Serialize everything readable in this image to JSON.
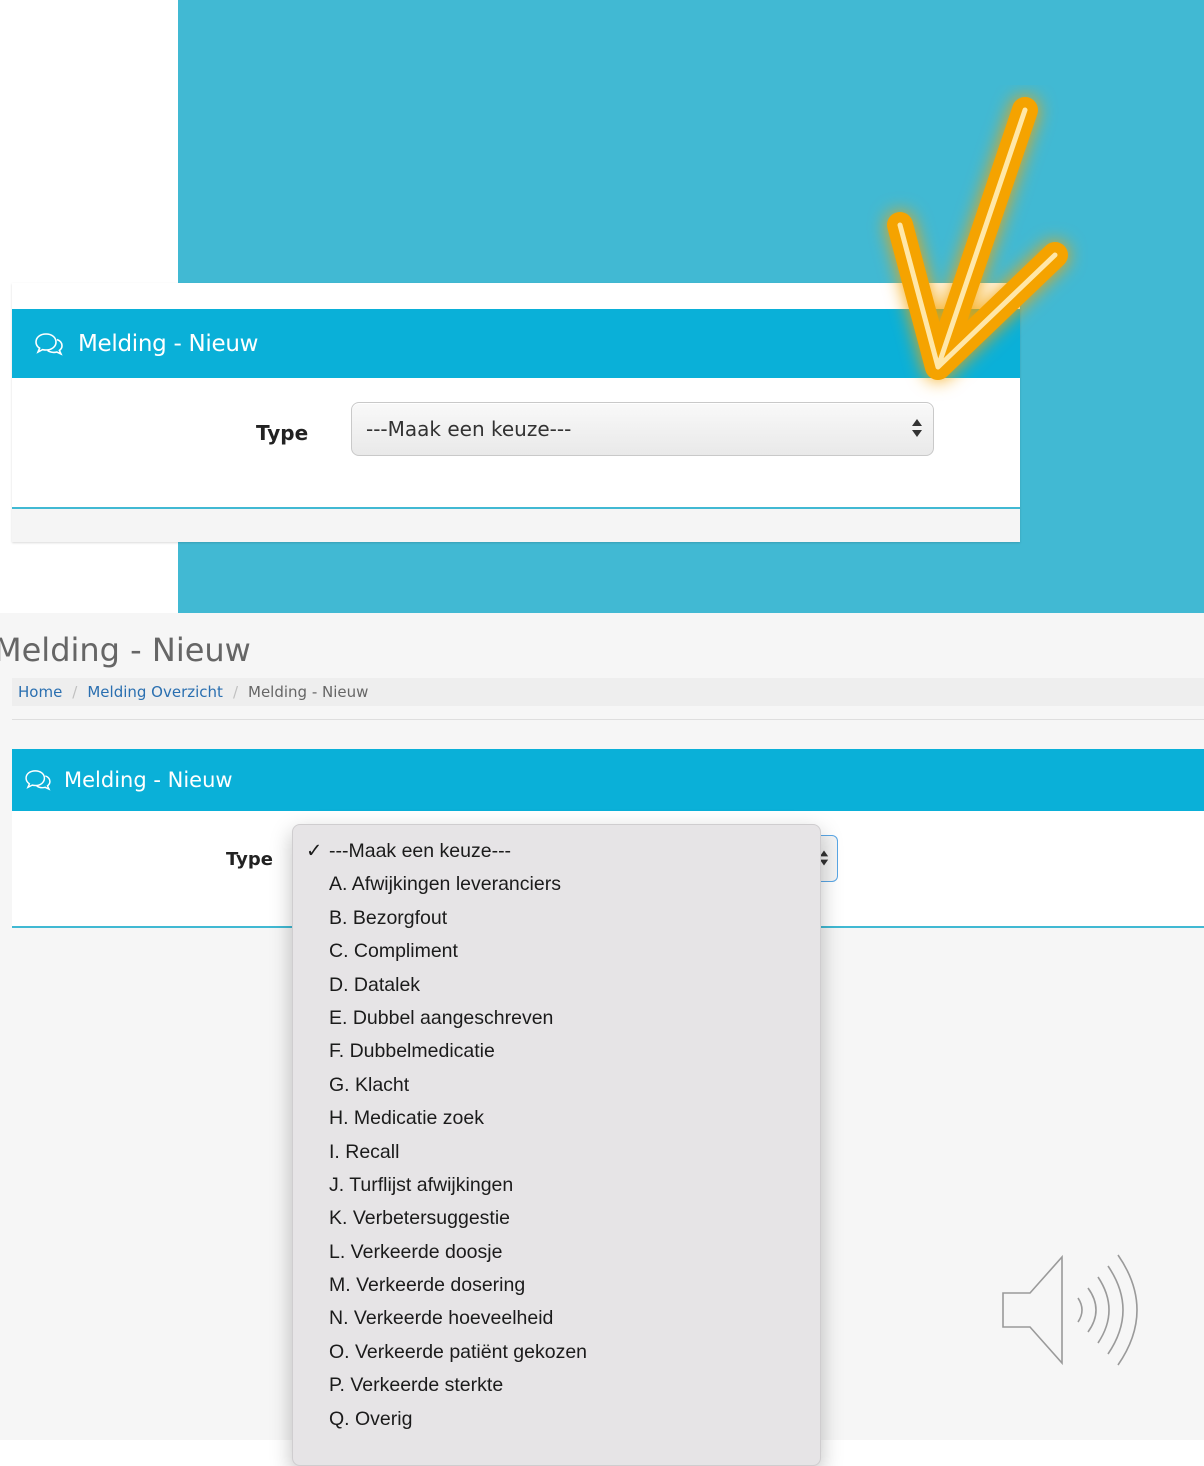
{
  "promo_card": {
    "header_title": "Melding - Nieuw",
    "type_label": "Type",
    "select_value": "---Maak een keuze---"
  },
  "app": {
    "page_title": "Melding - Nieuw",
    "breadcrumb": {
      "home": "Home",
      "overview": "Melding Overzicht",
      "current": "Melding - Nieuw"
    },
    "panel_title": "Melding - Nieuw",
    "type_label": "Type",
    "dropdown": {
      "selected_check": "✓",
      "options": [
        "---Maak een keuze---",
        "A. Afwijkingen leveranciers",
        "B. Bezorgfout",
        "C. Compliment",
        "D. Datalek",
        "E. Dubbel aangeschreven",
        "F. Dubbelmedicatie",
        "G. Klacht",
        "H. Medicatie zoek",
        "I. Recall",
        "J. Turflijst afwijkingen",
        "K. Verbetersuggestie",
        "L. Verkeerde doosje",
        "M. Verkeerde dosering",
        "N. Verkeerde hoeveelheid",
        "O. Verkeerde patiënt gekozen",
        "P. Verkeerde sterkte",
        "Q. Overig"
      ]
    }
  },
  "colors": {
    "teal_background": "#41b9d3",
    "header_blue": "#0ab0d8",
    "neon_orange": "#f5a300",
    "link_blue": "#2a6fb0"
  },
  "icons": [
    "chat-bubbles-icon",
    "select-arrows-icon",
    "checkmark-neon-icon",
    "speaker-icon"
  ]
}
